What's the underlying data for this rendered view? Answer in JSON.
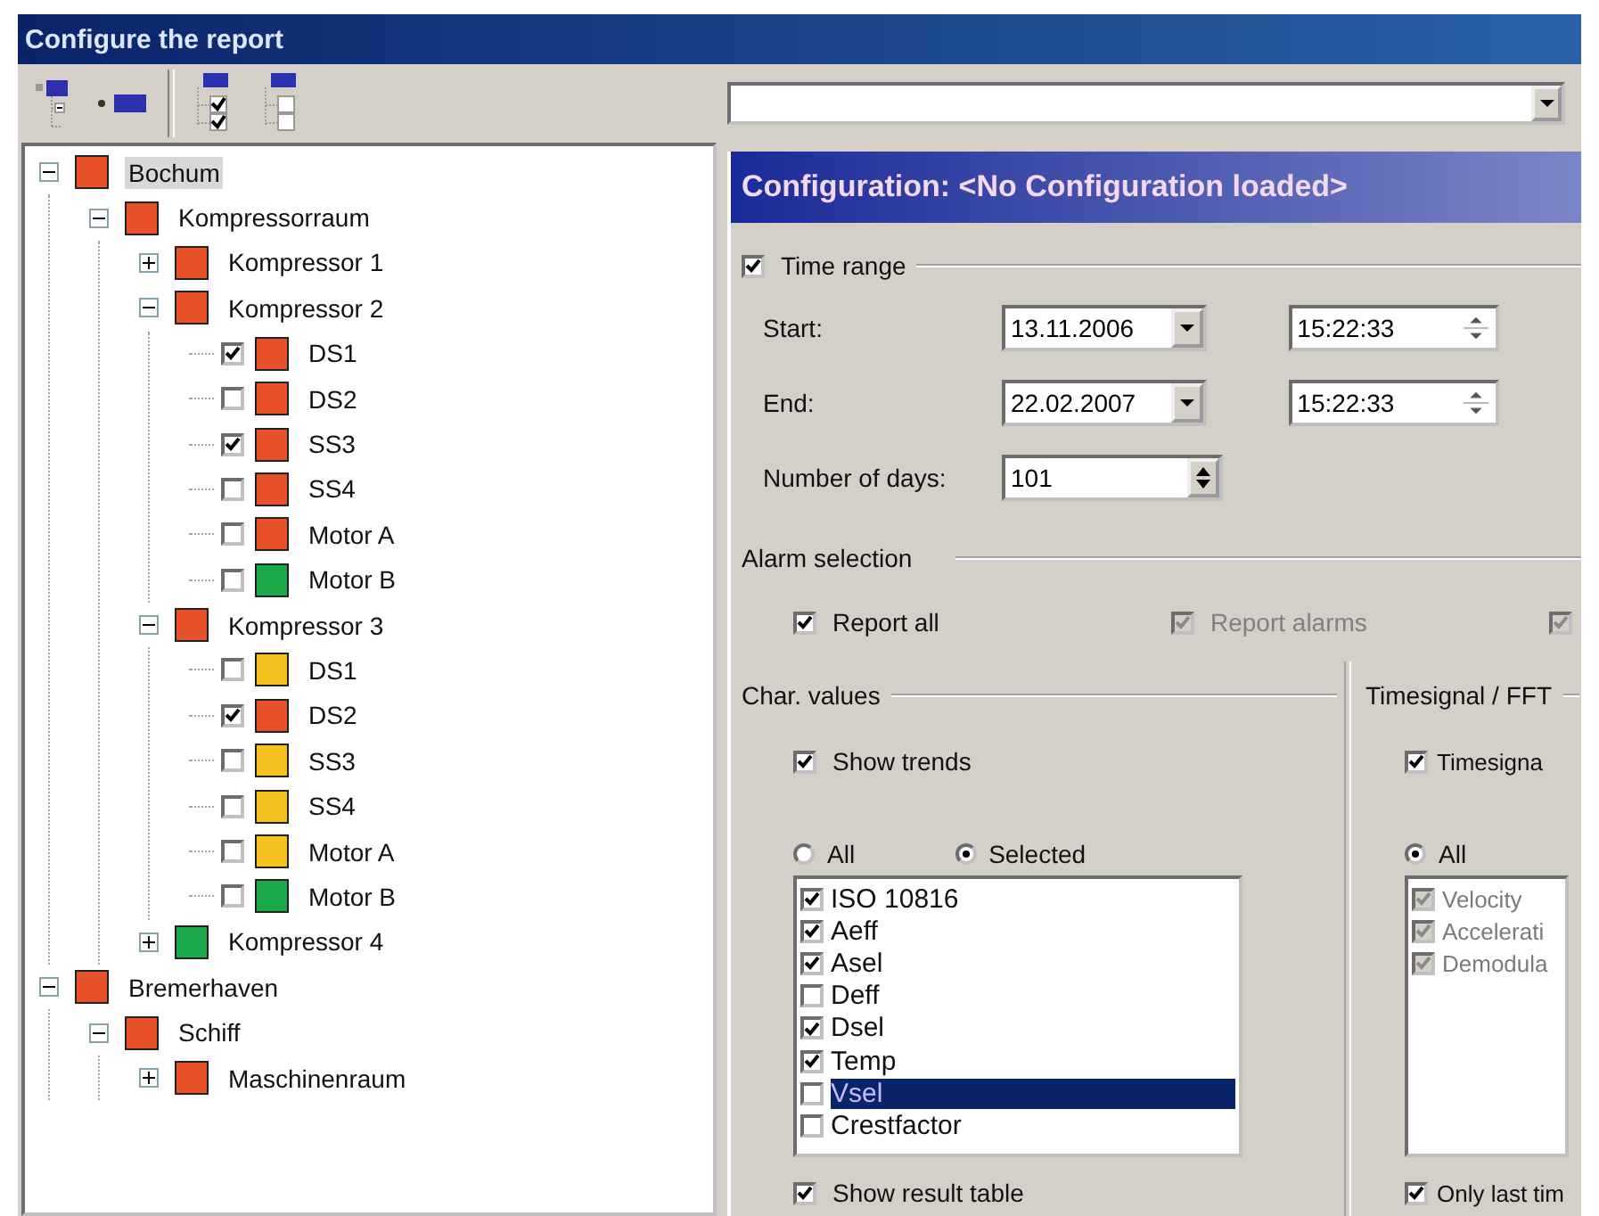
{
  "window": {
    "title": "Configure the report"
  },
  "toolbar": [
    {
      "kind": "collapse"
    },
    {
      "kind": "expand"
    },
    {
      "kind": "check-all"
    },
    {
      "kind": "uncheck-all"
    }
  ],
  "tree": [
    {
      "kind": "group",
      "label": "Bochum",
      "color": "#e8522a",
      "expanded": true,
      "selected": true,
      "children": [
        {
          "kind": "group",
          "label": "Kompressorraum",
          "color": "#e8522a",
          "expanded": true,
          "selected": false,
          "children": [
            {
              "kind": "group",
              "label": "Kompressor 1",
              "color": "#e8522a",
              "expanded": false,
              "selected": false
            },
            {
              "kind": "group",
              "label": "Kompressor 2",
              "color": "#e8522a",
              "expanded": true,
              "selected": false,
              "children": [
                {
                  "kind": "sensor",
                  "label": "DS1",
                  "color": "#e8522a",
                  "checked": true,
                  "selected": false
                },
                {
                  "kind": "sensor",
                  "label": "DS2",
                  "color": "#e8522a",
                  "checked": false,
                  "selected": false
                },
                {
                  "kind": "sensor",
                  "label": "SS3",
                  "color": "#e8522a",
                  "checked": true,
                  "selected": false
                },
                {
                  "kind": "sensor",
                  "label": "SS4",
                  "color": "#e8522a",
                  "checked": false,
                  "selected": false
                },
                {
                  "kind": "sensor",
                  "label": "Motor A",
                  "color": "#e8522a",
                  "checked": false,
                  "selected": false
                },
                {
                  "kind": "sensor",
                  "label": "Motor B",
                  "color": "#1aa84a",
                  "checked": false,
                  "selected": false
                }
              ]
            },
            {
              "kind": "group",
              "label": "Kompressor 3",
              "color": "#e8522a",
              "expanded": true,
              "selected": false,
              "children": [
                {
                  "kind": "sensor",
                  "label": "DS1",
                  "color": "#f5c11e",
                  "checked": false,
                  "selected": false
                },
                {
                  "kind": "sensor",
                  "label": "DS2",
                  "color": "#e8522a",
                  "checked": true,
                  "selected": false
                },
                {
                  "kind": "sensor",
                  "label": "SS3",
                  "color": "#f5c11e",
                  "checked": false,
                  "selected": false
                },
                {
                  "kind": "sensor",
                  "label": "SS4",
                  "color": "#f5c11e",
                  "checked": false,
                  "selected": false
                },
                {
                  "kind": "sensor",
                  "label": "Motor A",
                  "color": "#f5c11e",
                  "checked": false,
                  "selected": false
                },
                {
                  "kind": "sensor",
                  "label": "Motor B",
                  "color": "#1aa84a",
                  "checked": false,
                  "selected": false
                }
              ]
            },
            {
              "kind": "group",
              "label": "Kompressor 4",
              "color": "#1aa84a",
              "expanded": false,
              "selected": false
            }
          ]
        }
      ]
    },
    {
      "kind": "group",
      "label": "Bremerhaven",
      "color": "#e8522a",
      "expanded": true,
      "selected": false,
      "children": [
        {
          "kind": "group",
          "label": "Schiff",
          "color": "#e8522a",
          "expanded": true,
          "selected": false,
          "children": [
            {
              "kind": "group",
              "label": "Maschinenraum",
              "color": "#e8522a",
              "expanded": false,
              "selected": false
            }
          ]
        }
      ]
    }
  ],
  "config_header": {
    "title": "Configuration: <No Configuration loaded>"
  },
  "time_range": {
    "label": "Time range",
    "checked": true,
    "rows": [
      {
        "kind": "datetime",
        "label": "Start:",
        "date": "13.11.2006",
        "time": "15:22:33"
      },
      {
        "kind": "datetime",
        "label": "End:",
        "date": "22.02.2007",
        "time": "15:22:33"
      },
      {
        "kind": "spin",
        "label": "Number of days:",
        "value": "101"
      }
    ]
  },
  "alarm_selection": {
    "title": "Alarm selection",
    "options": [
      {
        "label": "Report all",
        "checked": true,
        "disabled": false
      },
      {
        "label": "Report alarms",
        "checked": true,
        "disabled": true
      },
      {
        "checked": true,
        "disabled": true
      }
    ]
  },
  "char_values": {
    "title": "Char. values",
    "option": {
      "label": "Show trends",
      "checked": true
    },
    "radios": [
      {
        "label": "All",
        "selected": false
      },
      {
        "label": "Selected",
        "selected": true
      }
    ],
    "disabled": false,
    "list": [
      {
        "label": "ISO 10816",
        "checked": true,
        "selected": false
      },
      {
        "label": "Aeff",
        "checked": true,
        "selected": false
      },
      {
        "label": "Asel",
        "checked": true,
        "selected": false
      },
      {
        "label": "Deff",
        "checked": false,
        "selected": false
      },
      {
        "label": "Dsel",
        "checked": true,
        "selected": false
      },
      {
        "label": "Temp",
        "checked": true,
        "selected": false
      },
      {
        "label": "Vsel",
        "checked": false,
        "selected": true
      },
      {
        "label": "Crestfactor",
        "checked": false,
        "selected": false
      }
    ],
    "footer": {
      "label": "Show result table",
      "checked": true
    }
  },
  "timesignal": {
    "title": "Timesignal / FFT",
    "option": {
      "label": "Timesigna",
      "checked": true
    },
    "radios": [
      {
        "label": "All",
        "selected": true
      }
    ],
    "disabled": true,
    "list": [
      {
        "label": "Velocity",
        "checked": true,
        "selected": false
      },
      {
        "label": "Accelerati",
        "checked": true,
        "selected": false
      },
      {
        "label": "Demodula",
        "checked": true,
        "selected": false
      }
    ],
    "footer": {
      "label": "Only last tim",
      "checked": true
    }
  }
}
